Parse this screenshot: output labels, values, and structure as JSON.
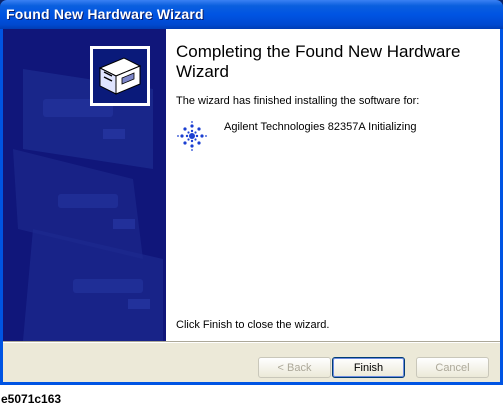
{
  "window": {
    "title": "Found New Hardware Wizard"
  },
  "wizard": {
    "heading": "Completing the Found New Hardware Wizard",
    "intro": "The wizard has finished installing the software for:",
    "device_name": "Agilent Technologies 82357A Initializing",
    "device_icon": "agilent-spark-icon",
    "closing_text": "Click Finish to close the wizard."
  },
  "buttons": {
    "back_label": "< Back",
    "finish_label": "Finish",
    "cancel_label": "Cancel"
  },
  "caption": "e5071c163",
  "colors": {
    "titlebar": "#0054e3",
    "side_panel": "#10167a",
    "dialog_bg": "#ece9d8",
    "agilent_blue": "#1b3fd1"
  }
}
